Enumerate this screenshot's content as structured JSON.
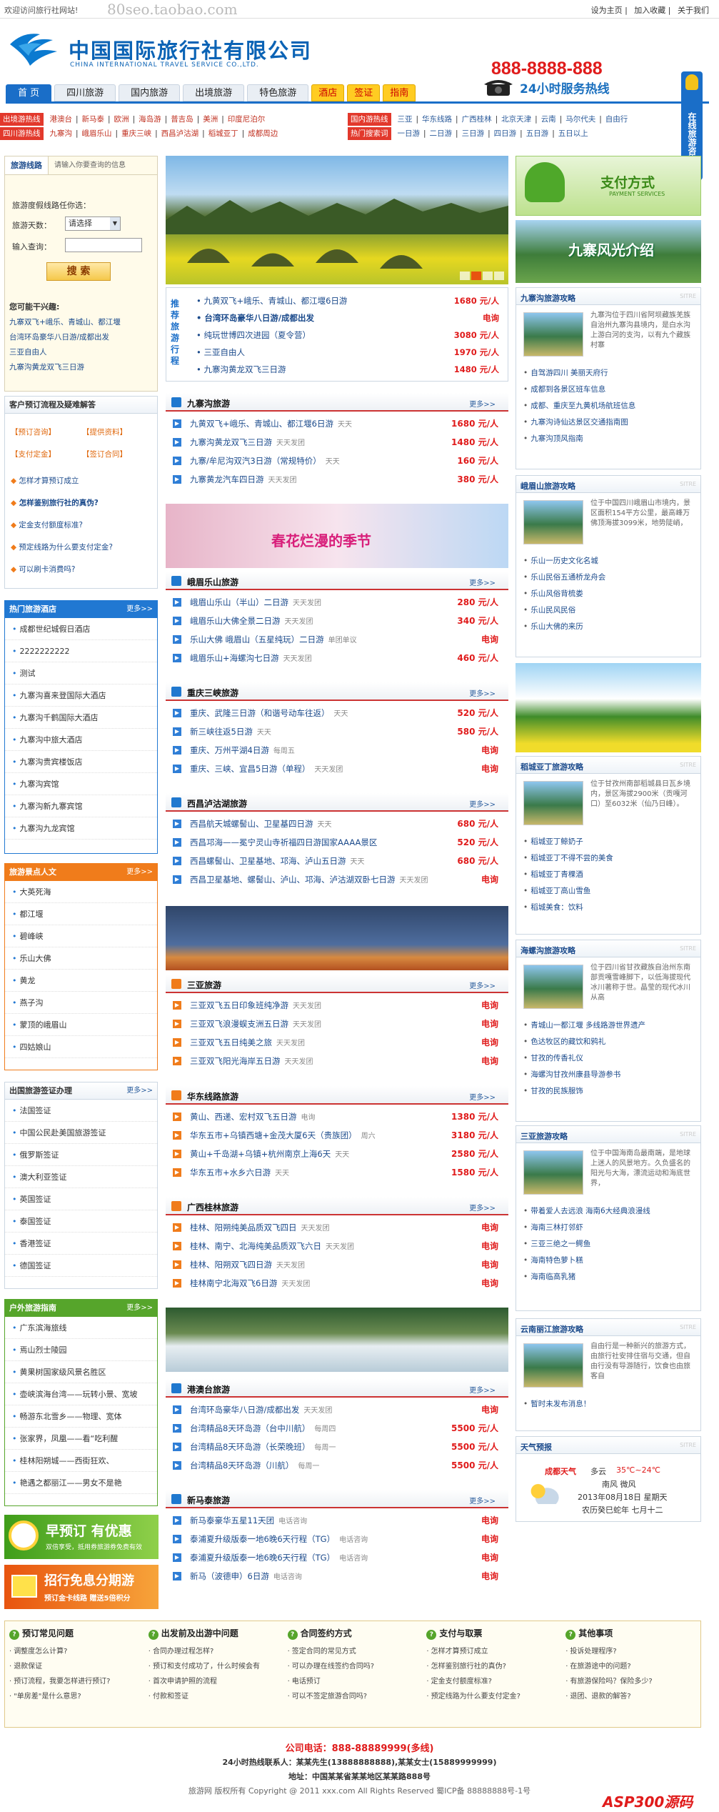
{
  "topbar": {
    "welcome": "欢迎访问旅行社网站!",
    "watermark": "80seo.taobao.com",
    "links": [
      "设为主页",
      "加入收藏",
      "关于我们"
    ]
  },
  "header": {
    "logo_cn": "中国国际旅行社有限公司",
    "logo_en": "CHINA INTERNATIONAL TRAVEL SERVICE CO.,LTD.",
    "hotline": "888-8888-888",
    "hotline_text": "24小时服务热线"
  },
  "nav": [
    "首 页",
    "四川旅游",
    "国内旅游",
    "出境旅游",
    "特色旅游",
    "酒店",
    "签证",
    "指南"
  ],
  "side_tab": "在线旅游咨询",
  "hot": {
    "label1": "出境游热线",
    "row1": [
      "港澳台",
      "新马泰",
      "欧洲",
      "海岛游",
      "普吉岛",
      "美洲",
      "印度尼泊尔"
    ],
    "label2": "四川游热线",
    "row2": [
      "九寨沟",
      "峨眉乐山",
      "重庆三峡",
      "西昌泸沽湖",
      "稻城亚丁",
      "成都周边"
    ],
    "label3": "国内游热线",
    "row3": [
      "三亚",
      "华东线路",
      "广西桂林",
      "北京天津",
      "云南",
      "马尔代夫",
      "自由行"
    ],
    "label4": "热门搜索词",
    "row4": [
      "一日游",
      "二日游",
      "三日游",
      "四日游",
      "五日游",
      "五日以上"
    ]
  },
  "search": {
    "tab1": "旅游线路",
    "tab2": "请输入你要查询的信息",
    "hint": "旅游度假线路任你选：",
    "days_label": "旅游天数：",
    "days_value": "请选择",
    "query_label": "输入查询：",
    "button": "搜 索"
  },
  "hotlines": {
    "title": "您可能干兴趣:",
    "items": [
      "九寨双飞+峨乐、青城山、都江堰",
      "台湾环岛豪华八日游/成都出发",
      "三亚自由人",
      "九寨沟黄龙双飞三日游"
    ]
  },
  "process": {
    "title": "客户预订流程及疑难解答",
    "btns": [
      "【预订咨询】",
      "【提供资料】",
      "【支付定金】",
      "【签订合同】"
    ],
    "items": [
      "怎样才算预订成立",
      "怎样鉴别旅行社的真伪?",
      "定金支付额度标准?",
      "预定线路为什么要支付定金?",
      "可以刷卡消费吗?"
    ]
  },
  "hotels": {
    "title": "热门旅游酒店",
    "more": "更多>>",
    "items": [
      "成都世纪城假日酒店",
      "2222222222",
      "测试",
      "九寨沟喜来登国际大酒店",
      "九寨沟千鹤国际大酒店",
      "九寨沟中旅大酒店",
      "九寨沟贵宾楼饭店",
      "九寨沟宾馆",
      "九寨沟新九寨宾馆",
      "九寨沟九龙宾馆"
    ]
  },
  "scenery": {
    "title": "旅游景点人文",
    "more": "更多>>",
    "items": [
      "大英死海",
      "都江堰",
      "碧峰峡",
      "乐山大佛",
      "黄龙",
      "燕子沟",
      "蒙顶的峨眉山",
      "四姑娘山"
    ]
  },
  "visa": {
    "title": "出国旅游签证办理",
    "more": "更多>>",
    "items": [
      "法国签证",
      "中国公民赴美国旅游签证",
      "俄罗斯签证",
      "澳大利亚签证",
      "英国签证",
      "泰国签证",
      "香港签证",
      "德国签证"
    ]
  },
  "outdoor": {
    "title": "户外旅游指南",
    "more": "更多>>",
    "items": [
      "广东滨海旅线",
      "焉山烈士陵园",
      "黄果树国家级风景名胜区",
      "壶峡滨海台湾——玩转小景、宽坡",
      "畅游东北雪乡——物理、宽体",
      "张家界，凤凰——看“吃利醒",
      "桂林阳朔城——西街狂欢、",
      "艳遇之都丽江——男女不是艳"
    ]
  },
  "promos": {
    "p1_title": "早预订 有优惠",
    "p1_sub": "双倍享受，抵用券旅游券免费有效",
    "p2_title": "招行免息分期游",
    "p2_sub": "预订金卡线路 赠送5倍积分"
  },
  "recommend": {
    "label": "推荐旅游行程",
    "items": [
      {
        "name": "九黄双飞+峨乐、青城山、都江堰6日游",
        "price": "1680 元/人"
      },
      {
        "name": "台湾环岛豪华八日游/成都出发",
        "price": "电询"
      },
      {
        "name": "纯玩世博四次进园（夏令营）",
        "price": "3080 元/人"
      },
      {
        "name": "三亚自由人",
        "price": "1970 元/人"
      },
      {
        "name": "九寨沟黄龙双飞三日游",
        "price": "1480 元/人"
      }
    ]
  },
  "pay": {
    "title": "支付方式",
    "sub": "PAYMENT SERVICES"
  },
  "jiuzhai_banner": "九寨风光介绍",
  "spring": "春花烂漫的季节",
  "sections": [
    {
      "title": "九寨沟旅游",
      "more": "更多>>",
      "items": [
        {
          "name": "九黄双飞+峨乐、青城山、都江堰6日游",
          "tag": "天天",
          "price": "1680 元/人"
        },
        {
          "name": "九寨沟黄龙双飞三日游",
          "tag": "天天发团",
          "price": "1480 元/人"
        },
        {
          "name": "九寨/牟尼沟双汽3日游（常规特价）",
          "tag": "天天",
          "price": "160 元/人"
        },
        {
          "name": "九寨黄龙汽车四日游",
          "tag": "天天发团",
          "price": "380 元/人"
        }
      ]
    },
    {
      "title": "峨眉乐山旅游",
      "more": "更多>>",
      "items": [
        {
          "name": "峨眉山乐山（半山）二日游",
          "tag": "天天发团",
          "price": "280 元/人"
        },
        {
          "name": "峨眉乐山大佛全景二日游",
          "tag": "天天发团",
          "price": "340 元/人"
        },
        {
          "name": "乐山大佛 峨眉山（五星纯玩）二日游",
          "tag": "单团单议",
          "price": "电询"
        },
        {
          "name": "峨眉乐山+海螺沟七日游",
          "tag": "天天发团",
          "price": "460 元/人"
        }
      ]
    },
    {
      "title": "重庆三峡旅游",
      "more": "更多>>",
      "items": [
        {
          "name": "重庆、武隆三日游（和谐号动车往返）",
          "tag": "天天",
          "price": "520 元/人"
        },
        {
          "name": "新三峡往返5日游",
          "tag": "天天",
          "price": "580 元/人"
        },
        {
          "name": "重庆、万州平湖4日游",
          "tag": "每周五",
          "price": "电询"
        },
        {
          "name": "重庆、三峡、宜昌5日游（单程）",
          "tag": "天天发团",
          "price": "电询"
        }
      ]
    },
    {
      "title": "西昌泸沽湖旅游",
      "more": "更多>>",
      "items": [
        {
          "name": "西昌航天城螺髻山、卫星基四日游",
          "tag": "天天",
          "price": "680 元/人"
        },
        {
          "name": "西昌邛海——冕宁灵山寺祈福四日游国家AAAA景区",
          "tag": "",
          "price": "520 元/人"
        },
        {
          "name": "西昌螺髻山、卫星基地、邛海、泸山五日游",
          "tag": "天天",
          "price": "680 元/人"
        },
        {
          "name": "西昌卫星基地、螺髻山、泸山、邛海、泸沽湖双卧七日游",
          "tag": "天天发团",
          "price": "电询"
        }
      ]
    },
    {
      "title": "三亚旅游",
      "more": "更多>>",
      "items": [
        {
          "name": "三亚双飞五日印象班纯净游",
          "tag": "天天发团",
          "price": "电询"
        },
        {
          "name": "三亚双飞浪漫蜈支洲五日游",
          "tag": "天天发团",
          "price": "电询"
        },
        {
          "name": "三亚双飞五日纯美之旅",
          "tag": "天天发团",
          "price": "电询"
        },
        {
          "name": "三亚双飞阳光海岸五日游",
          "tag": "天天发团",
          "price": "电询"
        }
      ]
    },
    {
      "title": "华东线路旅游",
      "more": "更多>>",
      "items": [
        {
          "name": "黄山、西递、宏村双飞五日游",
          "tag": "电询",
          "price": "1380 元/人"
        },
        {
          "name": "华东五市+乌镇西塘+金茂大厦6天（贵族团）",
          "tag": "周六",
          "price": "3180 元/人"
        },
        {
          "name": "黄山+千岛湖+乌镇+杭州南京上海6天",
          "tag": "天天",
          "price": "2580 元/人"
        },
        {
          "name": "华东五市+水乡六日游",
          "tag": "天天",
          "price": "1580 元/人"
        }
      ]
    },
    {
      "title": "广西桂林旅游",
      "more": "更多>>",
      "items": [
        {
          "name": "桂林、阳朔纯美品质双飞四日",
          "tag": "天天发团",
          "price": "电询"
        },
        {
          "name": "桂林、南宁、北海纯美品质双飞六日",
          "tag": "天天发团",
          "price": "电询"
        },
        {
          "name": "桂林、阳朔双飞四日游",
          "tag": "天天发团",
          "price": "电询"
        },
        {
          "name": "桂林南宁北海双飞6日游",
          "tag": "天天发团",
          "price": "电询"
        }
      ]
    },
    {
      "title": "港澳台旅游",
      "more": "更多>>",
      "items": [
        {
          "name": "台湾环岛豪华八日游/成都出发",
          "tag": "天天发团",
          "price": "电询"
        },
        {
          "name": "台湾精品8天环岛游（台中川航）",
          "tag": "每周四",
          "price": "5500 元/人"
        },
        {
          "name": "台湾精品8天环岛游（长荣晚班）",
          "tag": "每周一",
          "price": "5500 元/人"
        },
        {
          "name": "台湾精品8天环岛游（川航）",
          "tag": "每周一",
          "price": "5500 元/人"
        }
      ]
    },
    {
      "title": "新马泰旅游",
      "more": "更多>>",
      "items": [
        {
          "name": "新马泰豪华五星11天团",
          "tag": "电话咨询",
          "price": "电询"
        },
        {
          "name": "泰浦夏升级版泰一地6晚6天行程（TG）",
          "tag": "电话咨询",
          "price": "电询"
        },
        {
          "name": "泰浦夏升级版泰一地6晚6天行程（TG）",
          "tag": "电话咨询",
          "price": "电询"
        },
        {
          "name": "新马（波德申）6日游",
          "tag": "电话咨询",
          "price": "电询"
        }
      ]
    }
  ],
  "right": [
    {
      "title": "九寨沟旅游攻略",
      "desc": "九寨沟位于四川省阿坝藏族羌族自治州九寨沟县境内，是白水沟上游白河的支沟，以有九个藏族村寨",
      "links": [
        "自驾游四川 美丽天府行",
        "成都到各景区班车信息",
        "成都、重庆至九黄机场航班信息",
        "九寨沟诗仙达景区交通指南图",
        "九寨沟顶风指南"
      ]
    },
    {
      "title": "峨眉山旅游攻略",
      "desc": "位于中国四川峨眉山市境内，景区面积154平方公里，最高峰万佛顶海拔3099米，地势陡峭，",
      "links": [
        "乐山一历史文化名城",
        "乐山民俗五通桥龙舟会",
        "乐山风俗背梳娄",
        "乐山民风民俗",
        "乐山大佛的来历"
      ]
    },
    {
      "title": "稻城亚丁旅游攻略",
      "desc": "位于甘孜州南部稻城县日瓦乡境内，景区海拔2900米（贡嘎河口）至6032米（仙乃日峰）。",
      "links": [
        "稻城亚丁鲸奶子",
        "稻城亚丁不得不尝的美食",
        "稻城亚丁青棵酒",
        "稻城亚丁高山雪鱼",
        "稻城美食：饮料"
      ]
    },
    {
      "title": "海螺沟旅游攻略",
      "desc": "位于四川省甘孜藏族自治州东南部贡嘎雪峰脚下，以低海拔现代冰川著称于世。晶莹的现代冰川从高",
      "links": [
        "青城山一都江堰 多线路游世界遗产",
        "色达牧区的藏饮和鸦礼",
        "甘孜的传香礼仪",
        "海螺沟甘孜州康县导游参书",
        "甘孜的民族服饰"
      ]
    },
    {
      "title": "三亚旅游攻略",
      "desc": "位于中国海南岛最南端，是地球上迷人的风景地方。久负盛名的阳光与大海，漂流运动和海底世界，",
      "links": [
        "带着爱人去远浪 海南6大经典浪漫线",
        "海南三林打邻虾",
        "三亚三绝之一鳄鱼",
        "海南特色萝卜糕",
        "海南临高乳猪"
      ]
    },
    {
      "title": "云南丽江旅游攻略",
      "desc": "自由行是一种新兴的旅游方式，由旅行社安排住宿与交通，但自由行没有导游随行，饮食也由旅客自",
      "links": [
        "暂时未发布消息！"
      ]
    }
  ],
  "weather": {
    "title": "天气预报",
    "city": "成都天气",
    "cond": "多云",
    "temp": "35℃~24℃",
    "wind": "南风 微风",
    "date": "2013年08月18日 星期天",
    "lunar": "农历癸巳蛇年 七月十二"
  },
  "bottom": [
    {
      "title": "预订常见问题",
      "items": [
        "调整度怎么计算?",
        "退款保证",
        "预订流程，我要怎样进行预订?",
        "\"单房差\"是什么意思?"
      ]
    },
    {
      "title": "出发前及出游中问题",
      "items": [
        "合同办理过程怎样?",
        "预订和支付成功了，什么时候会有",
        "首次申请护照的流程",
        "付款和签证"
      ]
    },
    {
      "title": "合同签约方式",
      "items": [
        "签定合同的常见方式",
        "可以办理在线签约合同吗?",
        "电话预订",
        "可以不签定旅游合同吗?"
      ]
    },
    {
      "title": "支付与取票",
      "items": [
        "怎样才算预订成立",
        "怎样鉴别旅行社的真伪?",
        "定金支付额度标准?",
        "预定线路为什么要支付定金?"
      ]
    },
    {
      "title": "其他事项",
      "items": [
        "投诉处理程序?",
        "在旅游途中的问题?",
        "有旅游保险吗？保险多少?",
        "退团、退款的解答?"
      ]
    }
  ],
  "footer": {
    "phone_label": "公司电话：",
    "phone": "888-88889999(多线)",
    "line2": "24小时热线联系人：某某先生(13888888888),某某女士(15889999999)",
    "line3": "地址：中国某某省某某地区某某路888号",
    "line4": "旅游网 版权所有 Copyright @ 2011 xxx.com All Rights Reserved 蜀ICP备 88888888号-1号",
    "brand": "ASP300源码"
  }
}
